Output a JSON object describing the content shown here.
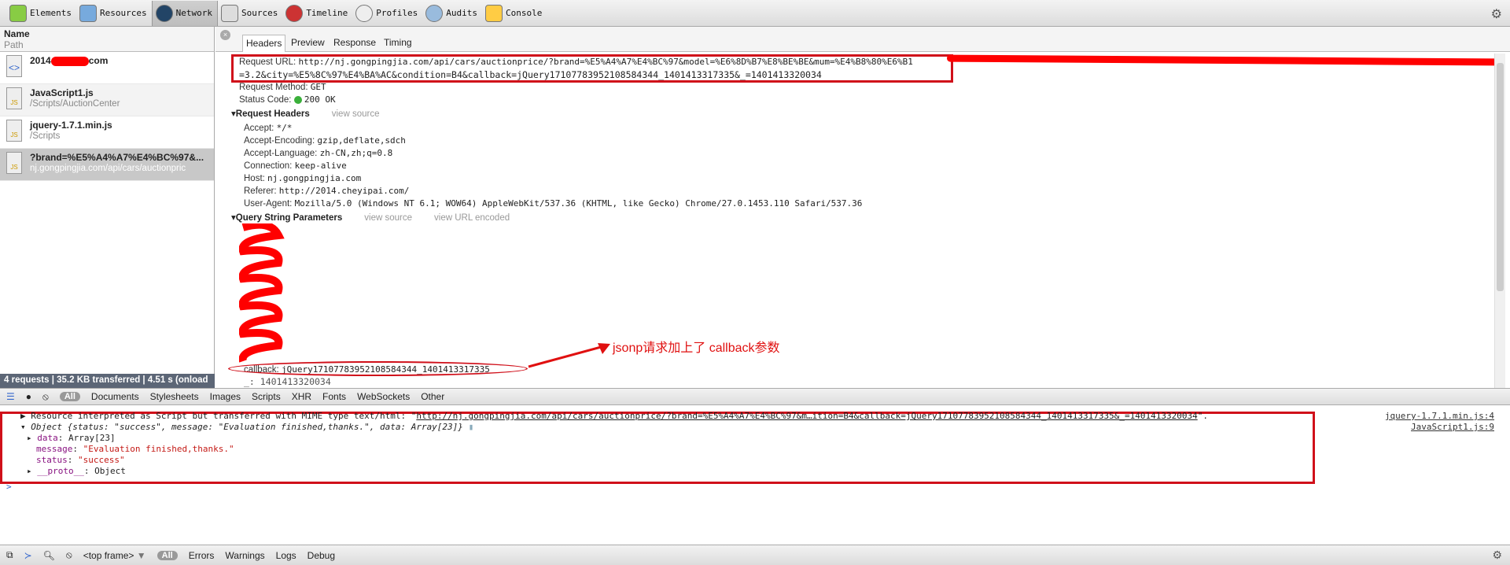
{
  "toolbar": {
    "items": [
      {
        "label": "Elements",
        "icon": "elements-icon"
      },
      {
        "label": "Resources",
        "icon": "resources-icon"
      },
      {
        "label": "Network",
        "icon": "network-icon",
        "selected": true
      },
      {
        "label": "Sources",
        "icon": "sources-icon"
      },
      {
        "label": "Timeline",
        "icon": "timeline-icon"
      },
      {
        "label": "Profiles",
        "icon": "profiles-icon"
      },
      {
        "label": "Audits",
        "icon": "audits-icon"
      },
      {
        "label": "Console",
        "icon": "console-icon"
      }
    ]
  },
  "requests": {
    "header_name": "Name",
    "header_path": "Path",
    "items": [
      {
        "name": "2014",
        "name_suffix": "com",
        "path": ""
      },
      {
        "name": "JavaScript1.js",
        "path": "/Scripts/AuctionCenter"
      },
      {
        "name": "jquery-1.7.1.min.js",
        "path": "/Scripts"
      },
      {
        "name": "?brand=%E5%A4%A7%E4%BC%97&...",
        "path": "nj.gongpingjia.com/api/cars/auctionpric"
      }
    ],
    "status": "4 requests | 35.2 KB transferred | 4.51 s (onload"
  },
  "detail": {
    "tabs": [
      "Headers",
      "Preview",
      "Response",
      "Timing"
    ],
    "request_url_label": "Request URL:",
    "request_url_line1": "http://nj.gongpingjia.com/api/cars/auctionprice/?brand=%E5%A4%A7%E4%BC%97&model=%E6%8D%B7%E8%BE%BE&mum=%E4%B8%80%E6%B1",
    "request_url_line2": "=3.2&city=%E5%8C%97%E4%BA%AC&condition=B4&callback=jQuery17107783952108584344_1401413317335&_=1401413320034",
    "method_label": "Request Method:",
    "method": "GET",
    "status_label": "Status Code:",
    "status": "200 OK",
    "status_color": "#3bb03b",
    "request_headers_title": "Request Headers",
    "view_source": "view source",
    "headers": [
      {
        "k": "Accept:",
        "v": "*/*"
      },
      {
        "k": "Accept-Encoding:",
        "v": "gzip,deflate,sdch"
      },
      {
        "k": "Accept-Language:",
        "v": "zh-CN,zh;q=0.8"
      },
      {
        "k": "Connection:",
        "v": "keep-alive"
      },
      {
        "k": "Host:",
        "v": "nj.gongpingjia.com"
      },
      {
        "k": "Referer:",
        "v": "http://2014.cheyipai.com/"
      },
      {
        "k": "User-Agent:",
        "v": "Mozilla/5.0 (Windows NT 6.1; WOW64) AppleWebKit/537.36 (KHTML, like Gecko) Chrome/27.0.1453.110 Safari/537.36"
      }
    ],
    "query_title": "Query String Parameters",
    "view_url_encoded": "view URL encoded",
    "callback_k": "callback:",
    "callback_v": "jQuery17107783952108584344_1401413317335",
    "underscore_v": "_: 1401413320034",
    "annotation": "jsonp请求加上了 callback参数",
    "annotation_color": "#e01010"
  },
  "filter": {
    "all": "All",
    "types": [
      "Documents",
      "Stylesheets",
      "Images",
      "Scripts",
      "XHR",
      "Fonts",
      "WebSockets",
      "Other"
    ]
  },
  "console": {
    "line1": "Resource interpreted as Script but transferred with MIME type text/html: \"",
    "line1_link": "http://nj.gongpingjia.com/api/cars/auctionprice/?brand=%E5%A4%A7%E4%BC%97&m…ition=B4&callback=jQuery17107783952108584344_1401413317335&_=1401413320034",
    "line1_end": "\".",
    "line1_src": "jquery-1.7.1.min.js:4",
    "obj_summary": "Object {status: \"success\", message: \"Evaluation finished,thanks.\", data: Array[23]}",
    "obj_src": "JavaScript1.js:9",
    "props": [
      {
        "k": "data",
        "v": "Array[23]",
        "expandable": true
      },
      {
        "k": "message",
        "v": "\"Evaluation finished,thanks.\""
      },
      {
        "k": "status",
        "v": "\"success\""
      },
      {
        "k": "__proto__",
        "v": "Object",
        "expandable": true
      }
    ],
    "prompt": ">"
  },
  "bottom": {
    "frame": "<top frame>",
    "all": "All",
    "levels": [
      "Errors",
      "Warnings",
      "Logs",
      "Debug"
    ]
  }
}
